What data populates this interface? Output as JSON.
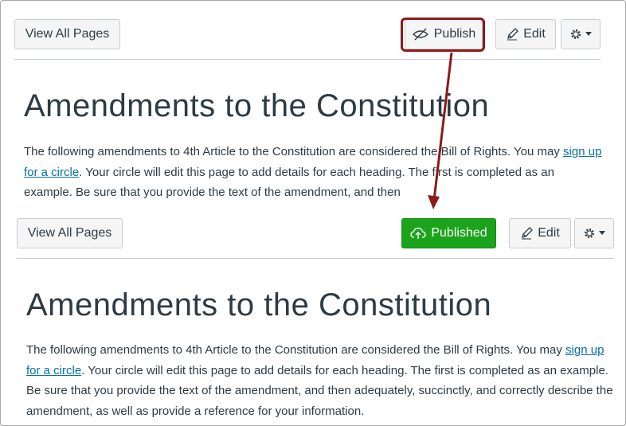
{
  "top": {
    "view_all_pages": "View All Pages",
    "publish_label": "Publish",
    "edit_label": "Edit",
    "title": "Amendments to the Constitution",
    "para_a": "The following amendments to 4th Article to the Constitution are considered the Bill of Rights. You may ",
    "para_link": "sign up for a circle",
    "para_b": ". Your circle will edit this page to add details for each heading. The first is completed as an example. Be sure that you provide the text of the amendment, and then"
  },
  "bottom": {
    "view_all_pages": "View All Pages",
    "published_label": "Published",
    "edit_label": "Edit",
    "title": "Amendments to the Constitution",
    "para_a": "The following amendments to 4th Article to the Constitution are considered the Bill of Rights. You may ",
    "para_link": "sign up for a circle",
    "para_b": ". Your circle will edit this page to add details for each heading. The first is completed as an example. Be sure that you provide the text of the amendment, and then adequately, succinctly, and correctly describe the amendment, as well as provide a reference for your information."
  },
  "colors": {
    "published_green": "#1ca31c",
    "highlight_red": "#8b1a1a",
    "link_blue": "#0770a3"
  },
  "icons": [
    "eye-slash-icon",
    "pencil-icon",
    "gear-icon",
    "caret-down-icon",
    "cloud-upload-icon"
  ]
}
